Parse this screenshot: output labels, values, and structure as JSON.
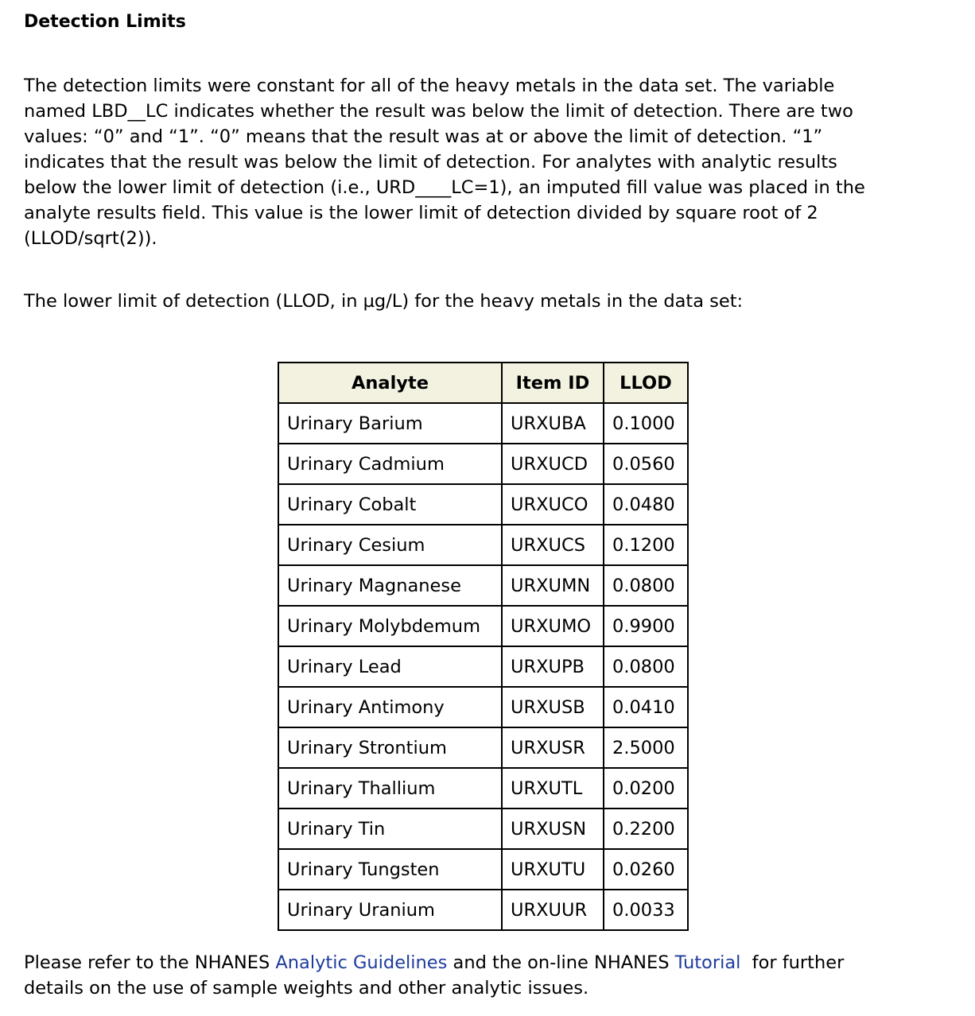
{
  "heading": "Detection Limits",
  "paragraph1_lines": [
    "The detection limits were constant for all of the heavy metals in the data set. The variable",
    "named LBD__LC indicates whether the result was below the limit of detection. There are two",
    "values: “0” and “1”. “0” means that the result was at or above the limit of detection. “1”",
    "indicates that the result was below the limit of detection. For analytes with analytic results",
    "below the lower limit of detection (i.e., URD____LC=1), an imputed fill value was placed in the",
    "analyte results field. This value is the lower limit of detection divided by square root of 2",
    "(LLOD/sqrt(2))."
  ],
  "paragraph2": "The lower limit of detection (LLOD, in µg/L) for the heavy metals in the data set:",
  "table": {
    "headers": [
      "Analyte",
      "Item ID",
      "LLOD"
    ],
    "rows": [
      [
        "Urinary Barium",
        "URXUBA",
        "0.1000"
      ],
      [
        "Urinary Cadmium",
        "URXUCD",
        "0.0560"
      ],
      [
        "Urinary Cobalt",
        "URXUCO",
        "0.0480"
      ],
      [
        "Urinary Cesium",
        "URXUCS",
        "0.1200"
      ],
      [
        "Urinary Magnanese",
        "URXUMN",
        "0.0800"
      ],
      [
        "Urinary Molybdemum",
        "URXUMO",
        "0.9900"
      ],
      [
        "Urinary Lead",
        "URXUPB",
        "0.0800"
      ],
      [
        "Urinary Antimony",
        "URXUSB",
        "0.0410"
      ],
      [
        "Urinary Strontium",
        "URXUSR",
        "2.5000"
      ],
      [
        "Urinary Thallium",
        "URXUTL",
        "0.0200"
      ],
      [
        "Urinary Tin",
        "URXUSN",
        "0.2200"
      ],
      [
        "Urinary Tungsten",
        "URXUTU",
        "0.0260"
      ],
      [
        "Urinary Uranium",
        "URXUUR",
        "0.0033"
      ]
    ]
  },
  "footer": {
    "text_before": "Please refer to the NHANES ",
    "link1": "Analytic Guidelines",
    "text_middle": " and the on-line NHANES ",
    "link2": "Tutorial",
    "text_after_line1": "  for further",
    "text_line2": "details on the use of sample weights and other analytic issues."
  },
  "colors": {
    "link": "#1f3c9e",
    "table_header_bg": "#f3f2e1",
    "border": "#000000"
  }
}
